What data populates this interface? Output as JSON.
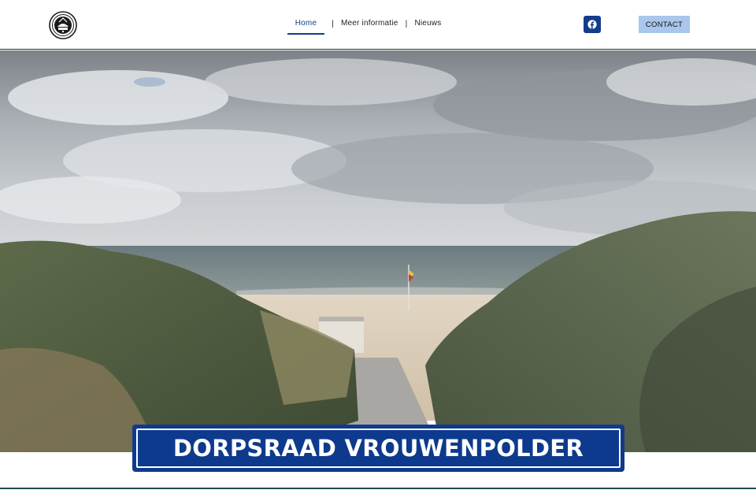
{
  "header": {
    "logo_icon": "dorpsraad-seal-logo",
    "nav": {
      "items": [
        {
          "label": "Home",
          "active": true
        },
        {
          "label": "Meer informatie",
          "active": false
        },
        {
          "label": "Nieuws",
          "active": false
        }
      ],
      "separator": "|"
    },
    "social_icon": "facebook-icon",
    "contact_label": "CONTACT"
  },
  "hero": {
    "image": "beach-path-through-dunes-photo",
    "title": "DORPSRAAD VROUWENPOLDER"
  },
  "colors": {
    "brand_blue": "#0e3a8d",
    "contact_bg": "#a9c6ec",
    "nav_active": "#143c8c"
  }
}
